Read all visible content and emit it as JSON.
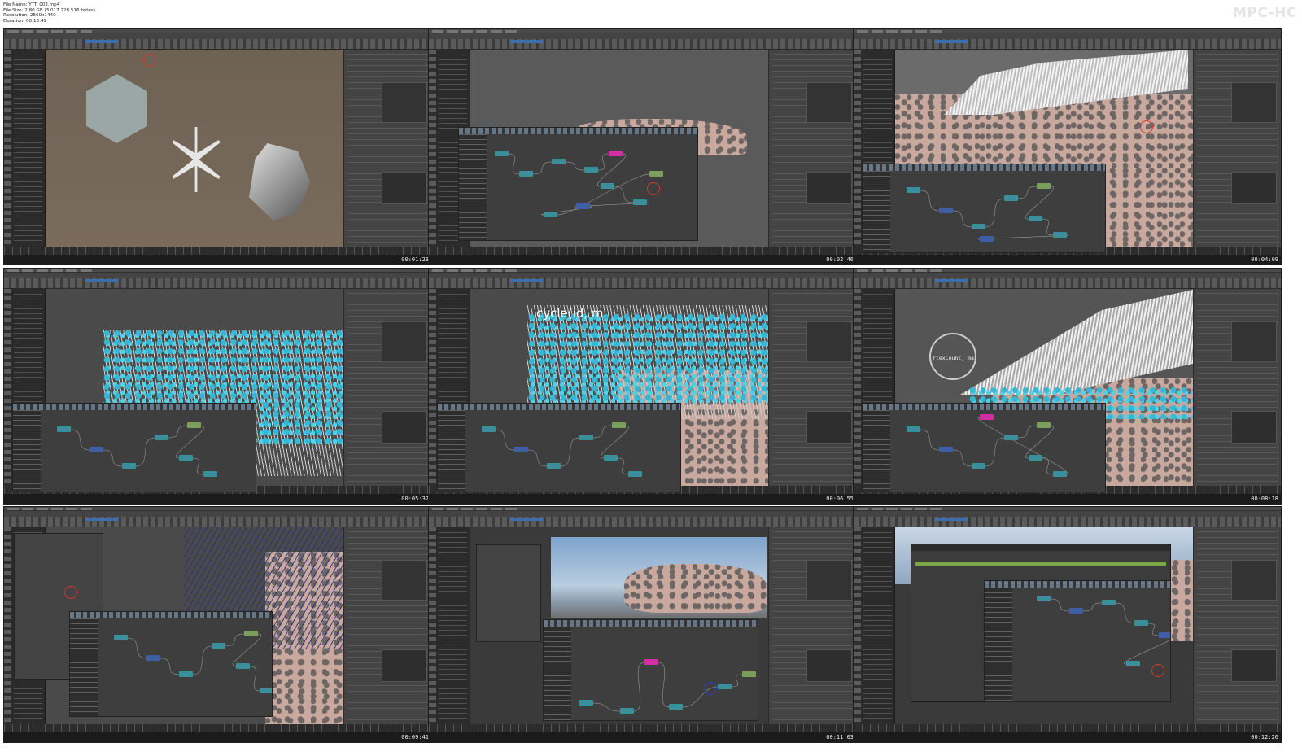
{
  "file_info": {
    "file_name": "File Name: YTT_002.mp4",
    "file_size": "File Size: 2.80 GB (3 017 228 516 bytes)",
    "resolution": "Resolution: 2560x1440",
    "duration": "Duration: 00:13:49"
  },
  "player_brand": "MPC-HC",
  "thumbnails": [
    {
      "timestamp": "00:01:23",
      "scene": "snowflake-objects"
    },
    {
      "timestamp": "00:02:46",
      "scene": "cheetah-node-graph"
    },
    {
      "timestamp": "00:04:09",
      "scene": "cheetah-fur-closeup"
    },
    {
      "timestamp": "00:05:32",
      "scene": "blue-instances"
    },
    {
      "timestamp": "00:06:55",
      "scene": "blue-instances-caption"
    },
    {
      "timestamp": "00:08:18",
      "scene": "fur-magnifier"
    },
    {
      "timestamp": "00:09:41",
      "scene": "fur-curves"
    },
    {
      "timestamp": "00:11:03",
      "scene": "cheetah-sky"
    },
    {
      "timestamp": "00:12:26",
      "scene": "render-settings"
    }
  ],
  "captions": {
    "thumb5": "cycle(id, m",
    "thumb6_magnifier": "rtexCount, max*verte"
  },
  "colors": {
    "maya_bg": "#3a3a3a",
    "node_teal": "#3b8f9a",
    "node_blue": "#3f5fa4",
    "node_green": "#7a9f5b",
    "node_magenta": "#d22ea6",
    "instance_cyan": "#35b8d6",
    "cheetah_fur": "#c9a99e",
    "accent_blue": "#3b6fb0"
  }
}
